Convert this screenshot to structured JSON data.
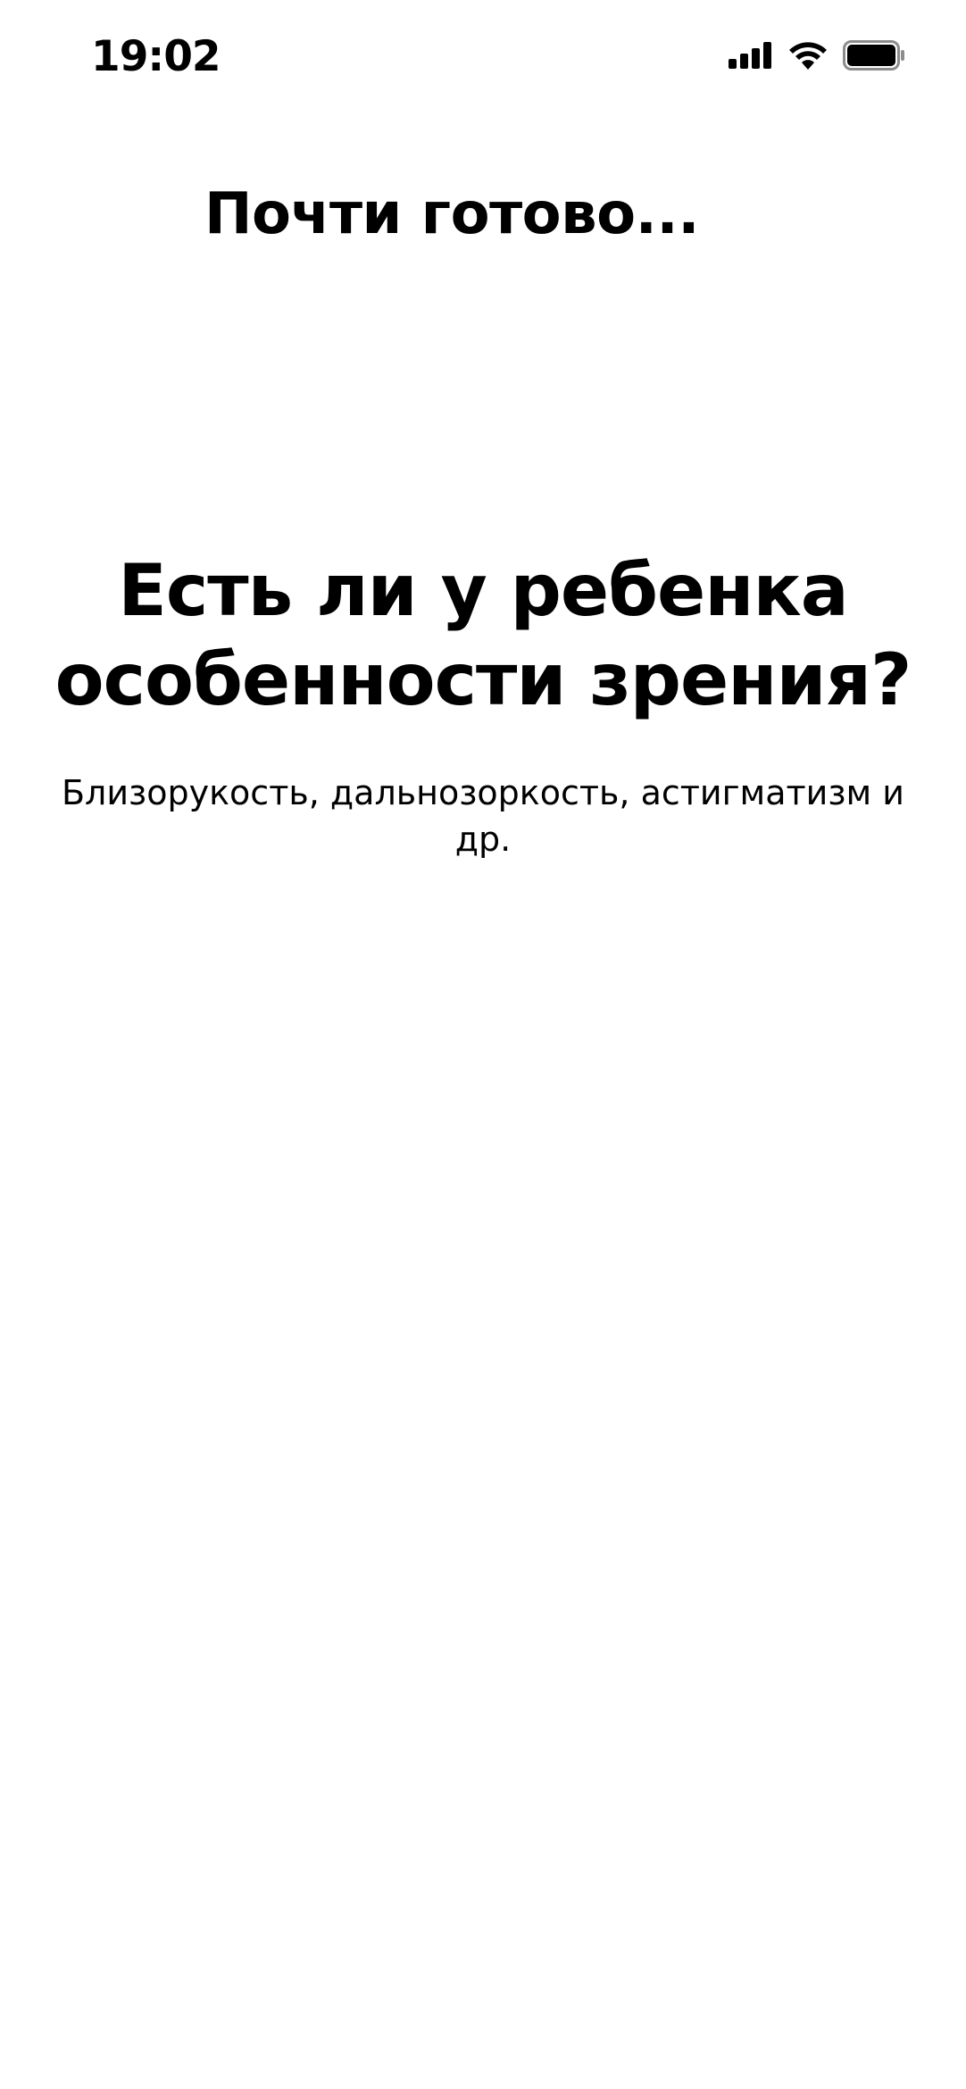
{
  "status_bar": {
    "time": "19:02",
    "icons": [
      "signal-icon",
      "wifi-icon",
      "battery-icon"
    ]
  },
  "header": {
    "title": "Почти готово..."
  },
  "question": {
    "title": "Есть ли у ребенка особенности зрения?",
    "subtitle": "Близорукость, дальнозоркость, астигматизм и др."
  },
  "colors": {
    "background": "#ffffff",
    "text": "#000000"
  }
}
